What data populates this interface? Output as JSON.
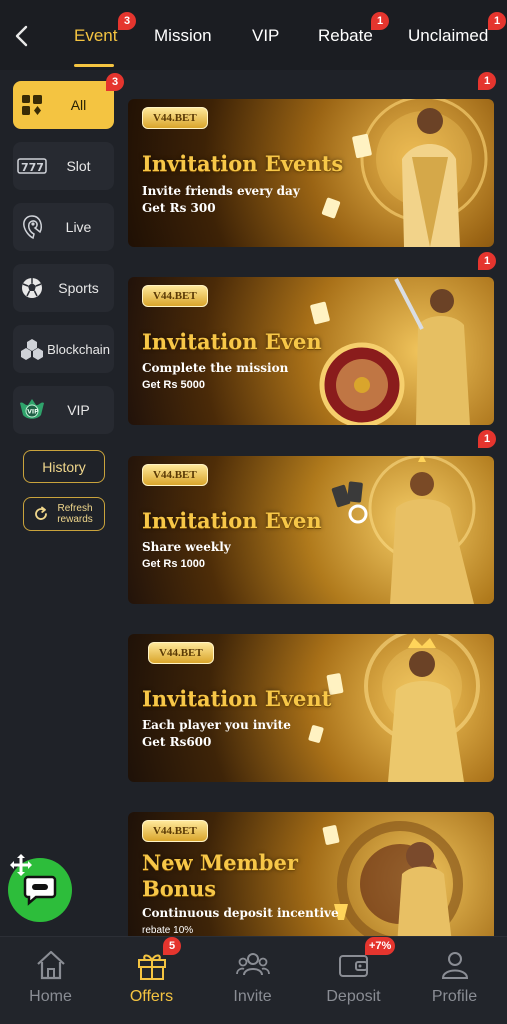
{
  "header": {
    "tabs": [
      {
        "label": "Event",
        "badge": "3",
        "active": true
      },
      {
        "label": "Mission",
        "badge": "",
        "active": false
      },
      {
        "label": "VIP",
        "badge": "",
        "active": false
      },
      {
        "label": "Rebate",
        "badge": "1",
        "active": false
      },
      {
        "label": "Unclaimed",
        "badge": "1",
        "active": false
      }
    ]
  },
  "sidebar": {
    "items": [
      {
        "label": "All",
        "badge": "3",
        "icon": "grid-icon",
        "active": true
      },
      {
        "label": "Slot",
        "icon": "slot-777-icon"
      },
      {
        "label": "Live",
        "icon": "live-dealer-icon"
      },
      {
        "label": "Sports",
        "icon": "soccer-ball-icon"
      },
      {
        "label": "Blockchain",
        "icon": "blockchain-icon"
      },
      {
        "label": "VIP",
        "icon": "vip-emblem-icon"
      }
    ],
    "history_label": "History",
    "refresh_label": "Refresh rewards"
  },
  "banners": [
    {
      "brand": "V44.BET",
      "title": "Invitation Events",
      "line1": "Invite friends every day",
      "line2": "Get Rs 300",
      "badge": "1"
    },
    {
      "brand": "V44.BET",
      "title": "Invitation Even",
      "line1": "Complete the mission",
      "line2": "Get Rs 5000",
      "badge": "1"
    },
    {
      "brand": "V44.BET",
      "title": "Invitation Even",
      "line1": "Share weekly",
      "line2": "Get Rs 1000",
      "badge": "1"
    },
    {
      "brand": "V44.BET",
      "title": "Invitation Event",
      "line1": "Each player you invite",
      "line2": "Get Rs600",
      "badge": ""
    },
    {
      "brand": "V44.BET",
      "title": "New Member",
      "title2": "Bonus",
      "line1": "Continuous deposit incentive",
      "line2": "rebate 10%",
      "badge": ""
    }
  ],
  "bottom_nav": {
    "items": [
      {
        "label": "Home",
        "icon": "home-icon",
        "badge": ""
      },
      {
        "label": "Offers",
        "icon": "gift-icon",
        "badge": "5",
        "active": true
      },
      {
        "label": "Invite",
        "icon": "invite-people-icon",
        "badge": ""
      },
      {
        "label": "Deposit",
        "icon": "wallet-icon",
        "badge": "+7%"
      },
      {
        "label": "Profile",
        "icon": "profile-icon",
        "badge": ""
      }
    ]
  },
  "colors": {
    "accent": "#f4c441",
    "badge": "#e5352e",
    "background": "#1f2228",
    "chat": "#2dbd3b"
  }
}
